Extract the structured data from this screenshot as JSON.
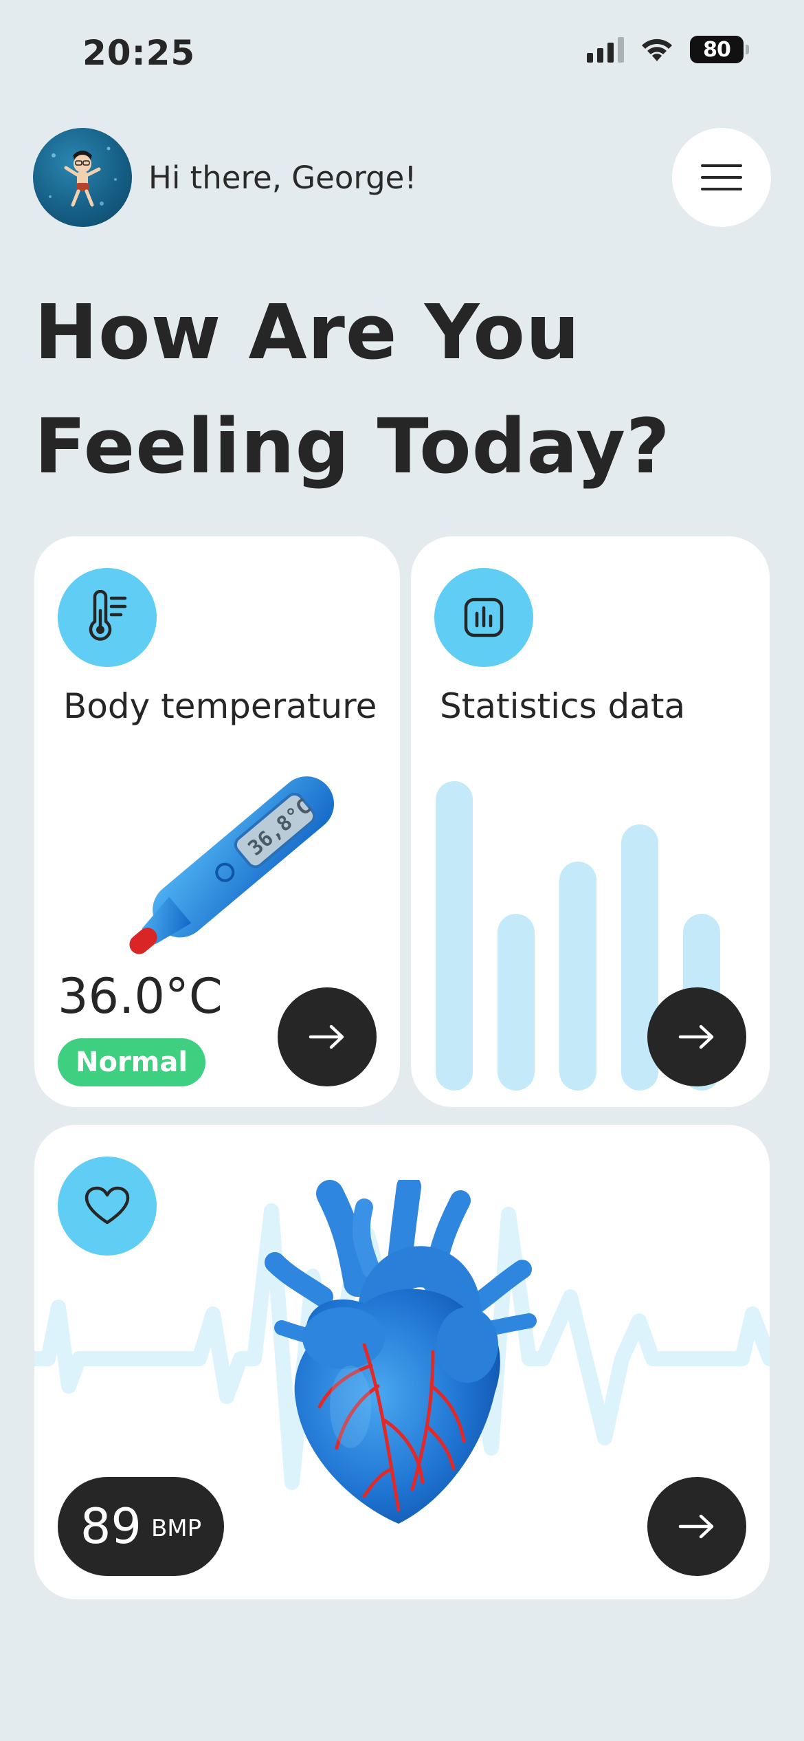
{
  "status_bar": {
    "time": "20:25",
    "battery": "80",
    "icons": [
      "signal-icon",
      "wifi-icon",
      "battery-icon"
    ]
  },
  "header": {
    "greeting": "Hi there, George!",
    "avatar": "avatar-icon",
    "menu": "menu-icon"
  },
  "headline": "How Are You Feeling Today?",
  "cards": {
    "temperature": {
      "title": "Body temperature",
      "icon": "thermometer-icon",
      "display_reading": "36,8°C",
      "value": "36.0°C",
      "status": "Normal",
      "status_color": "#3FCF80"
    },
    "statistics": {
      "title": "Statistics data",
      "icon": "chart-icon",
      "bar_levels": [
        1.0,
        0.57,
        0.74,
        0.86,
        0.57
      ],
      "bar_color": "#C4EAFA"
    },
    "heart": {
      "icon": "heart-icon",
      "bpm_value": "89",
      "bpm_unit": "BMP"
    }
  },
  "colors": {
    "background": "#E3EBEE",
    "accent": "#5FCDF4",
    "dark": "#262626",
    "card": "#FFFFFF"
  }
}
